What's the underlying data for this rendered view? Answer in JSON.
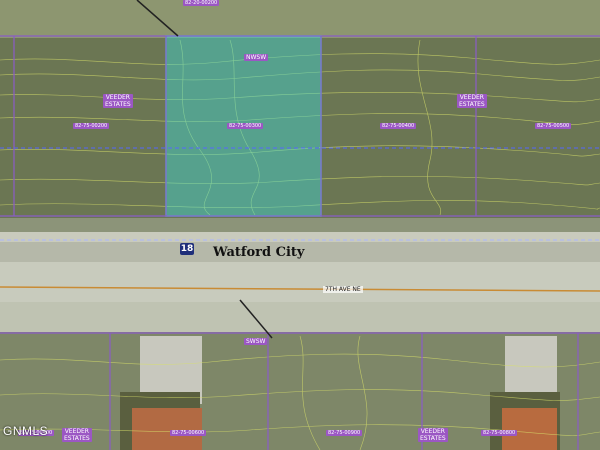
{
  "map": {
    "top_parcel_id": "82-20-00200",
    "subdivisions": {
      "upper_left": "VEEDER\nESTATES",
      "upper_right": "VEEDER\nESTATES",
      "lower_left": "VEEDER\nESTATES",
      "lower_right": "VEEDER\nESTATES"
    },
    "quarter_labels": {
      "upper": "NWSW",
      "lower": "SWSW"
    },
    "parcels_upper": [
      "82-75-00200",
      "82-75-00300",
      "82-75-00400",
      "82-75-00500"
    ],
    "parcels_lower": [
      "82-75-00400",
      "82-75-00600",
      "82-75-00900",
      "82-75-00800"
    ],
    "section_number": "18",
    "city_name": "Watford City",
    "road_name": "7TH AVE NE",
    "watermark": "GNMLS",
    "colors": {
      "highlight": "#3fd7d4",
      "parcel_line": "#8a5cc7",
      "section_line": "#5566ff",
      "contour": "#d8e06a"
    }
  }
}
